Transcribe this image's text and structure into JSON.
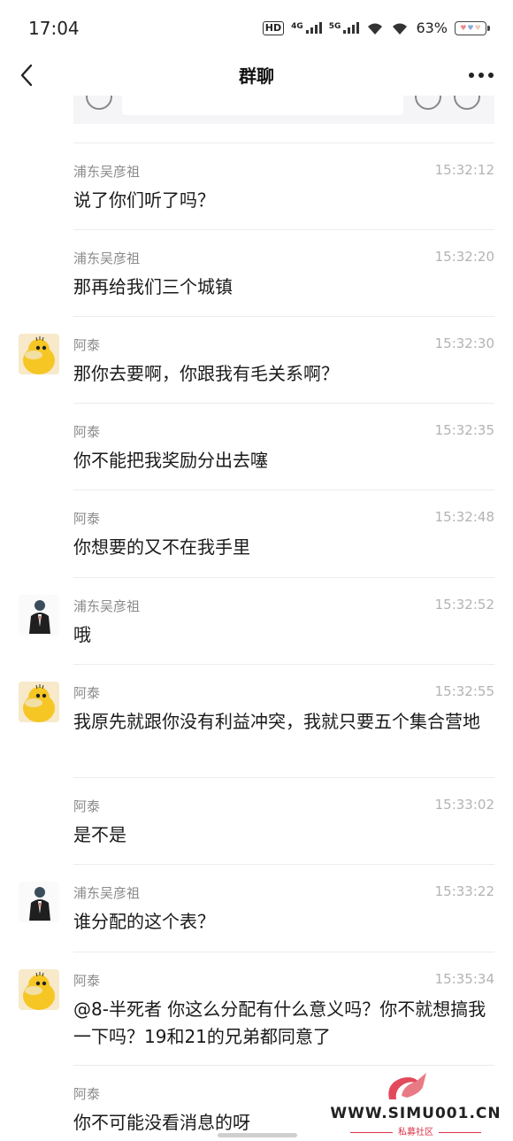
{
  "status": {
    "time": "17:04",
    "network1": "4G",
    "network2": "5G",
    "battery": "63%"
  },
  "header": {
    "title": "群聊"
  },
  "messages": [
    {
      "sender": "浦东吴彦祖",
      "time": "15:32:12",
      "text": "说了你们听了吗？",
      "avatar": "none"
    },
    {
      "sender": "浦东吴彦祖",
      "time": "15:32:20",
      "text": "那再给我们三个城镇",
      "avatar": "none"
    },
    {
      "sender": "阿泰",
      "time": "15:32:30",
      "text": "那你去要啊，你跟我有毛关系啊？",
      "avatar": "duck-avatar"
    },
    {
      "sender": "阿泰",
      "time": "15:32:35",
      "text": "你不能把我奖励分出去噻",
      "avatar": "none"
    },
    {
      "sender": "阿泰",
      "time": "15:32:48",
      "text": "你想要的又不在我手里",
      "avatar": "none"
    },
    {
      "sender": "浦东吴彦祖",
      "time": "15:32:52",
      "text": "哦",
      "avatar": "suit-avatar"
    },
    {
      "sender": "阿泰",
      "time": "15:32:55",
      "text": "我原先就跟你没有利益冲突，我就只要五个集合营地",
      "avatar": "duck-avatar"
    },
    {
      "sender": "阿泰",
      "time": "15:33:02",
      "text": "是不是",
      "avatar": "none"
    },
    {
      "sender": "浦东吴彦祖",
      "time": "15:33:22",
      "text": "谁分配的这个表？",
      "avatar": "suit-avatar"
    },
    {
      "sender": "阿泰",
      "time": "15:35:34",
      "text": "@8-半死者 你这么分配有什么意义吗？你不就想搞我一下吗？19和21的兄弟都同意了",
      "avatar": "duck-avatar"
    },
    {
      "sender": "阿泰",
      "time": "",
      "text": "你不可能没看消息的呀",
      "avatar": "none"
    }
  ],
  "watermark": {
    "site": "WWW.SIMU001.CN",
    "sub": "私募社区"
  }
}
